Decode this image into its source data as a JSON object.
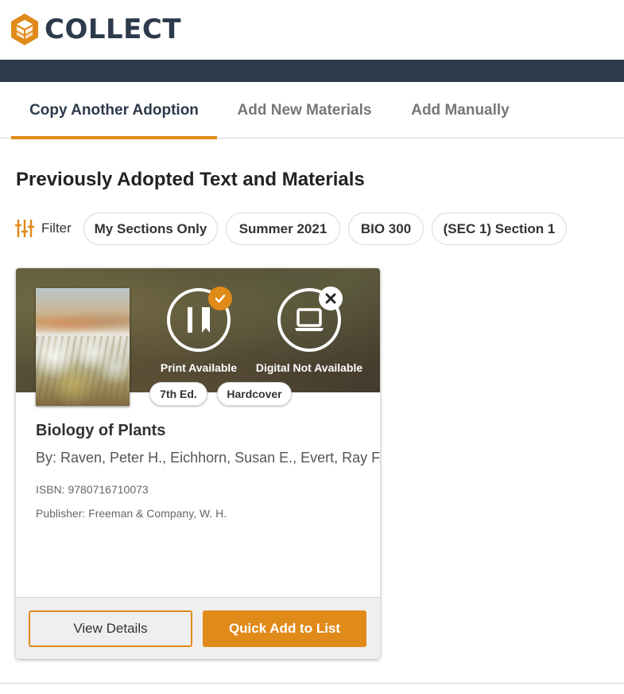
{
  "header": {
    "logo_text": "COLLECT",
    "logo_icon": "cube-hexagon-logo-icon",
    "brand_color": "#e08a1a",
    "navbar_color": "#2c3a4b"
  },
  "tabs": [
    {
      "label": "Copy Another Adoption",
      "active": true
    },
    {
      "label": "Add New Materials",
      "active": false
    },
    {
      "label": "Add Manually",
      "active": false
    }
  ],
  "section": {
    "title": "Previously Adopted Text and Materials"
  },
  "filter": {
    "label": "Filter",
    "icon": "sliders-icon",
    "chips": [
      "My Sections Only",
      "Summer 2021",
      "BIO 300",
      "(SEC 1) Section 1"
    ]
  },
  "card": {
    "availability": {
      "print": {
        "label": "Print Available",
        "icon": "book-icon",
        "status_icon": "check-icon"
      },
      "digital": {
        "label": "Digital Not Available",
        "icon": "laptop-icon",
        "status_icon": "close-icon"
      }
    },
    "edition": "7th Ed.",
    "format": "Hardcover",
    "title": "Biology of Plants",
    "authors": "By: Raven, Peter H., Eichhorn, Susan E., Evert, Ray F.",
    "isbn": "ISBN: 9780716710073",
    "publisher": "Publisher: Freeman & Company, W. H.",
    "buttons": {
      "details": "View Details",
      "quick_add": "Quick Add to List"
    }
  }
}
